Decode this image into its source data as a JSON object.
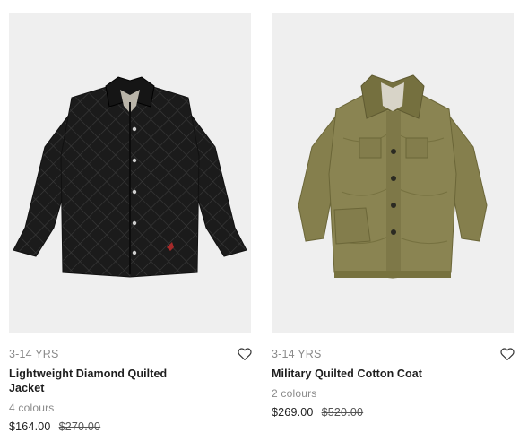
{
  "products": [
    {
      "age": "3-14 YRS",
      "name": "Lightweight Diamond Quilted Jacket",
      "colours": "4 colours",
      "price": "$164.00",
      "original_price": "$270.00",
      "image_alt": "black-quilted-jacket",
      "wishlist_icon": "heart-outline-icon"
    },
    {
      "age": "3-14 YRS",
      "name": "Military Quilted Cotton Coat",
      "colours": "2 colours",
      "price": "$269.00",
      "original_price": "$520.00",
      "image_alt": "olive-quilted-coat",
      "wishlist_icon": "heart-outline-icon"
    }
  ],
  "colors": {
    "image_background": "#efefef",
    "muted_text": "#8a8a8a",
    "jacket_black": "#1b1b1b",
    "coat_olive": "#8a8452"
  }
}
